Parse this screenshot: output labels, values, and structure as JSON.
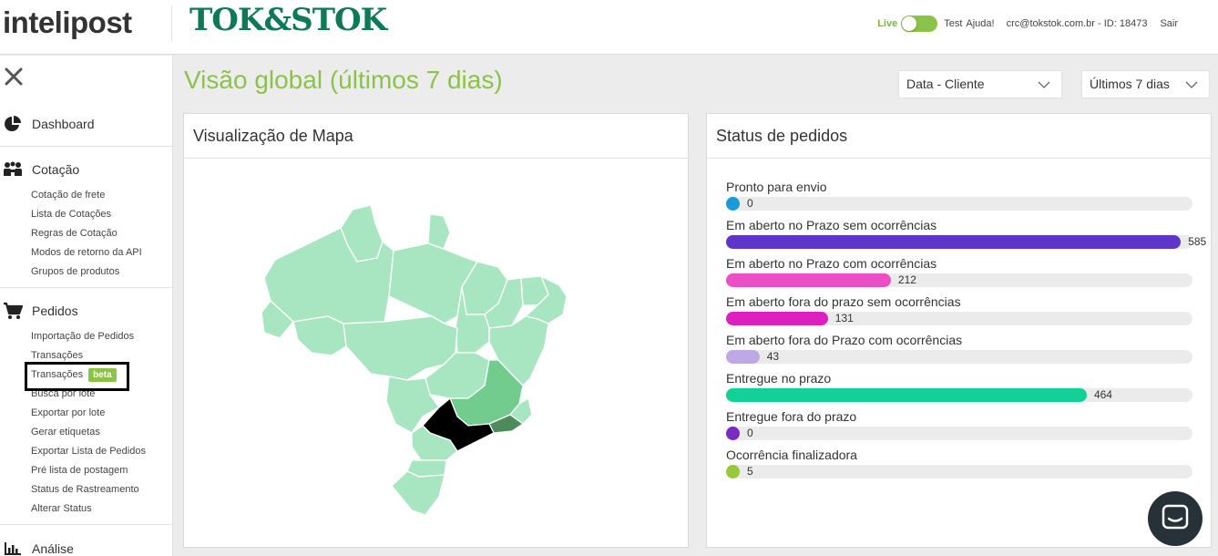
{
  "header": {
    "brand": "intelipost",
    "client_logo": "TOK&STOK",
    "env_live": "Live",
    "env_test": "Test",
    "help": "Ajuda!",
    "user": "crc@tokstok.com.br - ID: 18473",
    "logout": "Sair"
  },
  "sidebar": {
    "sections": [
      {
        "label": "Dashboard",
        "icon": "pie-chart-icon",
        "items": []
      },
      {
        "label": "Cotação",
        "icon": "people-icon",
        "items": [
          "Cotação de frete",
          "Lista de Cotações",
          "Regras de Cotação",
          "Modos de retorno da API",
          "Grupos de produtos"
        ]
      },
      {
        "label": "Pedidos",
        "icon": "cart-icon",
        "items": [
          "Importação de Pedidos",
          "Transações",
          "Transações",
          "Busca por lote",
          "Exportar por lote",
          "Gerar etiquetas",
          "Exportar Lista de Pedidos",
          "Pré lista de postagem",
          "Status de Rastreamento",
          "Alterar Status"
        ]
      },
      {
        "label": "Análise",
        "icon": "bar-chart-icon",
        "items": []
      }
    ],
    "beta_badge": "beta"
  },
  "main": {
    "title": "Visão global (últimos 7 dias)",
    "date_filter": "Data - Cliente",
    "period_filter": "Últimos 7 dias"
  },
  "map_panel": {
    "title": "Visualização de Mapa"
  },
  "status_panel": {
    "title": "Status de pedidos",
    "max": 600,
    "items": [
      {
        "label": "Pronto para envio",
        "value": 0,
        "color": "#1a9ad6"
      },
      {
        "label": "Em aberto no Prazo sem ocorrências",
        "value": 585,
        "color": "#5d35c8"
      },
      {
        "label": "Em aberto no Prazo com ocorrências",
        "value": 212,
        "color": "#ea4fc6"
      },
      {
        "label": "Em aberto fora do prazo sem ocorrências",
        "value": 131,
        "color": "#dd1fbe"
      },
      {
        "label": "Em aberto fora do Prazo com ocorrências",
        "value": 43,
        "color": "#bfa8e6"
      },
      {
        "label": "Entregue no prazo",
        "value": 464,
        "color": "#12d196"
      },
      {
        "label": "Entregue fora do prazo",
        "value": 0,
        "color": "#7b2bc4"
      },
      {
        "label": "Ocorrência finalizadora",
        "value": 5,
        "color": "#97c93b"
      }
    ]
  },
  "colors": {
    "brand_green": "#8bc34a",
    "logo_green": "#0e7a55",
    "map_base": "#a8e6c2",
    "map_mid": "#72cc8e",
    "map_dark": "#4e8a5c",
    "map_max": "#000000"
  }
}
